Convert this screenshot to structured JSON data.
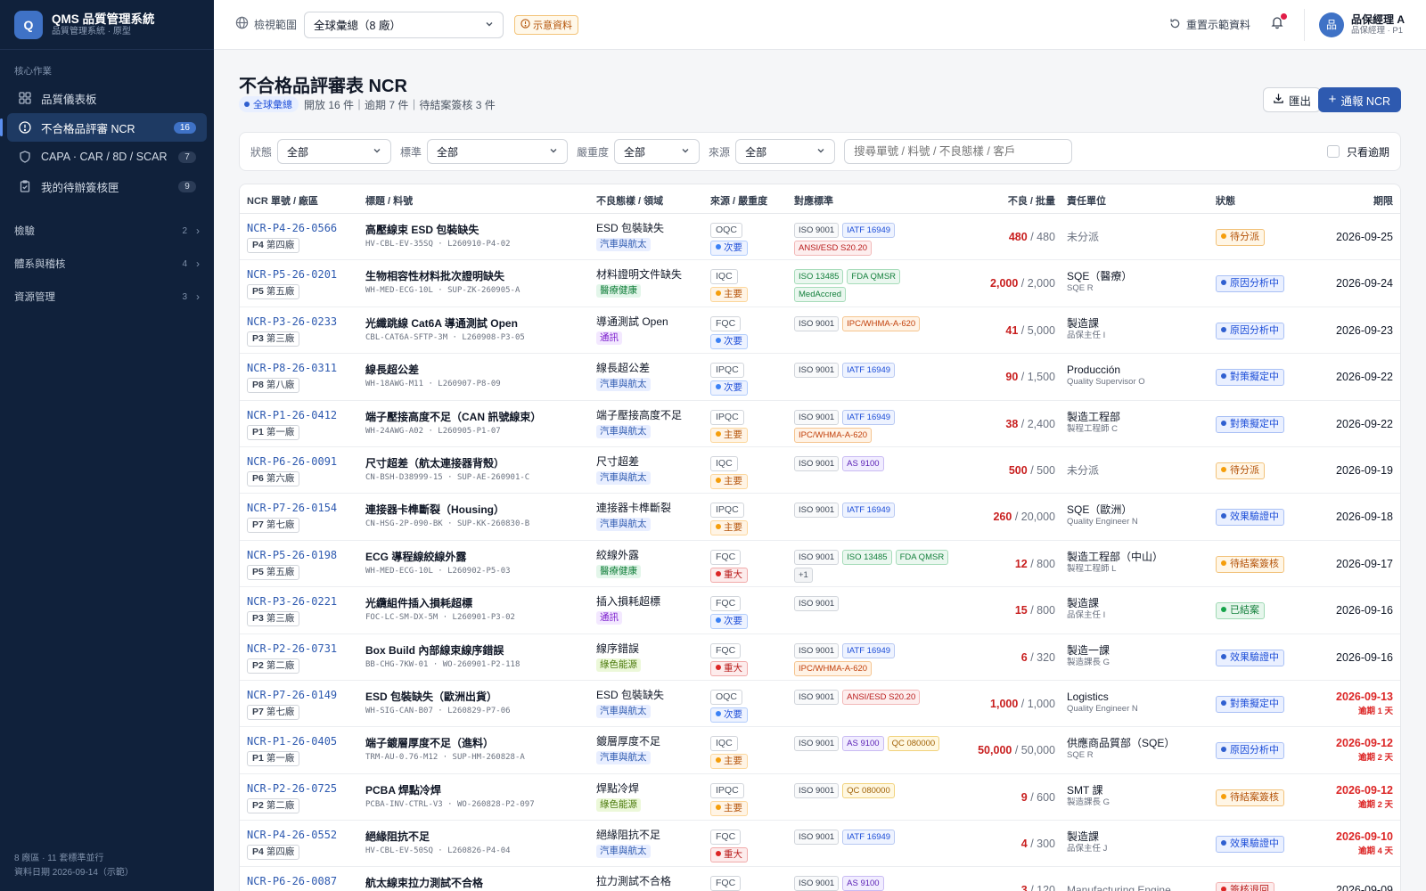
{
  "app": {
    "logo": "Q",
    "title": "QMS 品質管理系統",
    "subtitle": "品質管理系統 · 原型"
  },
  "sidebar": {
    "section": "核心作業",
    "items": [
      {
        "label": "品質儀表板",
        "badge": ""
      },
      {
        "label": "不合格品評審 NCR",
        "badge": "16"
      },
      {
        "label": "CAPA · CAR / 8D / SCAR",
        "badge": "7"
      },
      {
        "label": "我的待辦簽核匣",
        "badge": "9"
      }
    ],
    "groups": [
      {
        "label": "檢驗",
        "count": "2"
      },
      {
        "label": "體系與稽核",
        "count": "4"
      },
      {
        "label": "資源管理",
        "count": "3"
      }
    ],
    "footer": [
      "8 廠區 · 11 套標準並行",
      "資料日期 2026-09-14（示範）"
    ]
  },
  "topbar": {
    "scope_label": "檢視範圍",
    "scope_value": "全球彙總（8 廠）",
    "demo_tag": "示意資料",
    "reset": "重置示範資料",
    "user_initial": "品",
    "user_name": "品保經理 A",
    "user_role": "品保經理 · P1"
  },
  "page": {
    "title": "不合格品評審表 NCR",
    "scope_pill": "全球彙總",
    "summary": "開放 16 件｜逾期 7 件｜待結案簽核 3 件",
    "export": "匯出",
    "new": "通報 NCR"
  },
  "filters": {
    "status_label": "狀態",
    "status_value": "全部",
    "standard_label": "標準",
    "standard_value": "全部",
    "severity_label": "嚴重度",
    "severity_value": "全部",
    "source_label": "來源",
    "source_value": "全部",
    "search_placeholder": "搜尋單號 / 料號 / 不良態樣 / 客戶",
    "overdue_only": "只看逾期"
  },
  "table": {
    "headers": [
      "NCR 單號 / 廠區",
      "標題 / 料號",
      "不良態樣 / 領域",
      "來源 / 嚴重度",
      "對應標準",
      "不良 / 批量",
      "責任單位",
      "狀態",
      "期限"
    ],
    "rows": [
      {
        "id": "NCR-P4-26-0566",
        "plant": "P4",
        "plant_name": "第四廠",
        "title": "高壓線束 ESD 包裝缺失",
        "part": "HV-CBL-EV-35SQ · L260910-P4-02",
        "defect": "ESD 包裝缺失",
        "domain": "汽車與航太",
        "source": "OQC",
        "severity": "次要",
        "standards": [
          "ISO 9001",
          "IATF 16949",
          "ANSI/ESD S20.20"
        ],
        "ng": "480",
        "lot": "480",
        "unit": "未分派",
        "person": "",
        "status": "待分派",
        "due": "2026-09-25",
        "late": ""
      },
      {
        "id": "NCR-P5-26-0201",
        "plant": "P5",
        "plant_name": "第五廠",
        "title": "生物相容性材料批次證明缺失",
        "part": "WH-MED-ECG-10L · SUP-ZK-260905-A",
        "defect": "材料證明文件缺失",
        "domain": "醫療健康",
        "source": "IQC",
        "severity": "主要",
        "standards": [
          "ISO 13485",
          "FDA QMSR",
          "MedAccred"
        ],
        "ng": "2,000",
        "lot": "2,000",
        "unit": "SQE（醫療）",
        "person": "SQE R",
        "status": "原因分析中",
        "due": "2026-09-24",
        "late": ""
      },
      {
        "id": "NCR-P3-26-0233",
        "plant": "P3",
        "plant_name": "第三廠",
        "title": "光纖跳線 Cat6A 導通測試 Open",
        "part": "CBL-CAT6A-SFTP-3M · L260908-P3-05",
        "defect": "導通測試 Open",
        "domain": "通訊",
        "source": "FQC",
        "severity": "次要",
        "standards": [
          "ISO 9001",
          "IPC/WHMA-A-620"
        ],
        "ng": "41",
        "lot": "5,000",
        "unit": "製造課",
        "person": "品保主任 I",
        "status": "原因分析中",
        "due": "2026-09-23",
        "late": ""
      },
      {
        "id": "NCR-P8-26-0311",
        "plant": "P8",
        "plant_name": "第八廠",
        "title": "線長超公差",
        "part": "WH-18AWG-M11 · L260907-P8-09",
        "defect": "線長超公差",
        "domain": "汽車與航太",
        "source": "IPQC",
        "severity": "次要",
        "standards": [
          "ISO 9001",
          "IATF 16949"
        ],
        "ng": "90",
        "lot": "1,500",
        "unit": "Producción",
        "person": "Quality Supervisor O",
        "status": "對策擬定中",
        "due": "2026-09-22",
        "late": ""
      },
      {
        "id": "NCR-P1-26-0412",
        "plant": "P1",
        "plant_name": "第一廠",
        "title": "端子壓接高度不足（CAN 訊號線束）",
        "part": "WH-24AWG-A02 · L260905-P1-07",
        "defect": "端子壓接高度不足",
        "domain": "汽車與航太",
        "source": "IPQC",
        "severity": "主要",
        "standards": [
          "ISO 9001",
          "IATF 16949",
          "IPC/WHMA-A-620"
        ],
        "ng": "38",
        "lot": "2,400",
        "unit": "製造工程部",
        "person": "製程工程師 C",
        "status": "對策擬定中",
        "due": "2026-09-22",
        "late": ""
      },
      {
        "id": "NCR-P6-26-0091",
        "plant": "P6",
        "plant_name": "第六廠",
        "title": "尺寸超差（航太連接器背殼）",
        "part": "CN-BSH-D38999-15 · SUP-AE-260901-C",
        "defect": "尺寸超差",
        "domain": "汽車與航太",
        "source": "IQC",
        "severity": "主要",
        "standards": [
          "ISO 9001",
          "AS 9100"
        ],
        "ng": "500",
        "lot": "500",
        "unit": "未分派",
        "person": "",
        "status": "待分派",
        "due": "2026-09-19",
        "late": ""
      },
      {
        "id": "NCR-P7-26-0154",
        "plant": "P7",
        "plant_name": "第七廠",
        "title": "連接器卡榫斷裂（Housing）",
        "part": "CN-HSG-2P-090-BK · SUP-KK-260830-B",
        "defect": "連接器卡榫斷裂",
        "domain": "汽車與航太",
        "source": "IPQC",
        "severity": "主要",
        "standards": [
          "ISO 9001",
          "IATF 16949"
        ],
        "ng": "260",
        "lot": "20,000",
        "unit": "SQE（歐洲）",
        "person": "Quality Engineer N",
        "status": "效果驗證中",
        "due": "2026-09-18",
        "late": ""
      },
      {
        "id": "NCR-P5-26-0198",
        "plant": "P5",
        "plant_name": "第五廠",
        "title": "ECG 導程線絞線外露",
        "part": "WH-MED-ECG-10L · L260902-P5-03",
        "defect": "絞線外露",
        "domain": "醫療健康",
        "source": "FQC",
        "severity": "重大",
        "standards": [
          "ISO 9001",
          "ISO 13485",
          "FDA QMSR",
          "+1"
        ],
        "ng": "12",
        "lot": "800",
        "unit": "製造工程部（中山）",
        "person": "製程工程師 L",
        "status": "待結案簽核",
        "due": "2026-09-17",
        "late": ""
      },
      {
        "id": "NCR-P3-26-0221",
        "plant": "P3",
        "plant_name": "第三廠",
        "title": "光纜組件插入損耗超標",
        "part": "FOC-LC-SM-DX-5M · L260901-P3-02",
        "defect": "插入損耗超標",
        "domain": "通訊",
        "source": "FQC",
        "severity": "次要",
        "standards": [
          "ISO 9001"
        ],
        "ng": "15",
        "lot": "800",
        "unit": "製造課",
        "person": "品保主任 I",
        "status": "已結案",
        "due": "2026-09-16",
        "late": ""
      },
      {
        "id": "NCR-P2-26-0731",
        "plant": "P2",
        "plant_name": "第二廠",
        "title": "Box Build 內部線束線序錯誤",
        "part": "BB-CHG-7KW-01 · WO-260901-P2-118",
        "defect": "線序錯誤",
        "domain": "綠色能源",
        "source": "FQC",
        "severity": "重大",
        "standards": [
          "ISO 9001",
          "IATF 16949",
          "IPC/WHMA-A-620"
        ],
        "ng": "6",
        "lot": "320",
        "unit": "製造一課",
        "person": "製造課長 G",
        "status": "效果驗證中",
        "due": "2026-09-16",
        "late": ""
      },
      {
        "id": "NCR-P7-26-0149",
        "plant": "P7",
        "plant_name": "第七廠",
        "title": "ESD 包裝缺失（歐洲出貨）",
        "part": "WH-SIG-CAN-B07 · L260829-P7-06",
        "defect": "ESD 包裝缺失",
        "domain": "汽車與航太",
        "source": "OQC",
        "severity": "次要",
        "standards": [
          "ISO 9001",
          "ANSI/ESD S20.20"
        ],
        "ng": "1,000",
        "lot": "1,000",
        "unit": "Logistics",
        "person": "Quality Engineer N",
        "status": "對策擬定中",
        "due": "2026-09-13",
        "late": "逾期 1 天"
      },
      {
        "id": "NCR-P1-26-0405",
        "plant": "P1",
        "plant_name": "第一廠",
        "title": "端子鍍層厚度不足（進料）",
        "part": "TRM-AU-0.76-M12 · SUP-HM-260828-A",
        "defect": "鍍層厚度不足",
        "domain": "汽車與航太",
        "source": "IQC",
        "severity": "主要",
        "standards": [
          "ISO 9001",
          "AS 9100",
          "QC 080000"
        ],
        "ng": "50,000",
        "lot": "50,000",
        "unit": "供應商品質部（SQE）",
        "person": "SQE R",
        "status": "原因分析中",
        "due": "2026-09-12",
        "late": "逾期 2 天"
      },
      {
        "id": "NCR-P2-26-0725",
        "plant": "P2",
        "plant_name": "第二廠",
        "title": "PCBA 焊點冷焊",
        "part": "PCBA-INV-CTRL-V3 · WO-260828-P2-097",
        "defect": "焊點冷焊",
        "domain": "綠色能源",
        "source": "IPQC",
        "severity": "主要",
        "standards": [
          "ISO 9001",
          "QC 080000"
        ],
        "ng": "9",
        "lot": "600",
        "unit": "SMT 課",
        "person": "製造課長 G",
        "status": "待結案簽核",
        "due": "2026-09-12",
        "late": "逾期 2 天"
      },
      {
        "id": "NCR-P4-26-0552",
        "plant": "P4",
        "plant_name": "第四廠",
        "title": "絕緣阻抗不足",
        "part": "HV-CBL-EV-50SQ · L260826-P4-04",
        "defect": "絕緣阻抗不足",
        "domain": "汽車與航太",
        "source": "FQC",
        "severity": "重大",
        "standards": [
          "ISO 9001",
          "IATF 16949"
        ],
        "ng": "4",
        "lot": "300",
        "unit": "製造課",
        "person": "品保主任 J",
        "status": "效果驗證中",
        "due": "2026-09-10",
        "late": "逾期 4 天"
      },
      {
        "id": "NCR-P6-26-0087",
        "plant": "P6",
        "plant_name": "第六廠",
        "title": "航太線束拉力測試不合格",
        "part": "",
        "defect": "拉力測試不合格",
        "domain": "",
        "source": "FQC",
        "severity": "",
        "standards": [
          "ISO 9001",
          "AS 9100"
        ],
        "ng": "3",
        "lot": "120",
        "unit": "Manufacturing Engine…",
        "person": "",
        "status": "簽核退回",
        "due": "2026-09-09",
        "late": ""
      }
    ]
  },
  "colors": {
    "domain": {
      "汽車與航太": [
        "#e8eeff",
        "#2e5ab0"
      ],
      "醫療健康": [
        "#e3f6ea",
        "#15803d"
      ],
      "通訊": [
        "#f3e8ff",
        "#7e22ce"
      ],
      "綠色能源": [
        "#ecf8d9",
        "#4d7c0f"
      ]
    },
    "severity": {
      "次要": [
        "#eef3ff",
        "#1d4ed8",
        "#3b82f6"
      ],
      "主要": [
        "#fff4e5",
        "#b45309",
        "#f59e0b"
      ],
      "重大": [
        "#fdecec",
        "#b91c1c",
        "#dc2626"
      ]
    },
    "status": {
      "待分派": [
        "#fff6e6",
        "#b45309",
        "#f2c27a",
        "#f59e0b"
      ],
      "原因分析中": [
        "#eaf0ff",
        "#1d4ed8",
        "#a9c0f5",
        "#2f5fd0"
      ],
      "對策擬定中": [
        "#eaf0ff",
        "#1d4ed8",
        "#a9c0f5",
        "#2f5fd0"
      ],
      "效果驗證中": [
        "#eaf0ff",
        "#1d4ed8",
        "#a9c0f5",
        "#2f5fd0"
      ],
      "待結案簽核": [
        "#fff6e6",
        "#b45309",
        "#f2c27a",
        "#f59e0b"
      ],
      "已結案": [
        "#e6f6ec",
        "#15803d",
        "#9fd9b4",
        "#16a34a"
      ],
      "簽核退回": [
        "#fdecec",
        "#b91c1c",
        "#f3b2b2",
        "#dc2626"
      ]
    },
    "standard": {
      "ISO 9001": [
        "#f9fafb",
        "#374151",
        "#d1d5db"
      ],
      "IATF 16949": [
        "#eef3ff",
        "#1d4ed8",
        "#b7c8f2"
      ],
      "ANSI/ESD S20.20": [
        "#fdeeee",
        "#b91c1c",
        "#f2b8b8"
      ],
      "ISO 13485": [
        "#eaf7ef",
        "#15803d",
        "#a7dcba"
      ],
      "FDA QMSR": [
        "#eaf7ef",
        "#15803d",
        "#a7dcba"
      ],
      "MedAccred": [
        "#eaf7ef",
        "#15803d",
        "#a7dcba"
      ],
      "IPC/WHMA-A-620": [
        "#fff3e6",
        "#c2410c",
        "#f5c48f"
      ],
      "AS 9100": [
        "#f1edff",
        "#5b21b6",
        "#c9bbf3"
      ],
      "QC 080000": [
        "#fff8e1",
        "#a16207",
        "#f1d27c"
      ],
      "+1": [
        "#f3f4f6",
        "#4b5563",
        "#d1d5db"
      ]
    }
  }
}
